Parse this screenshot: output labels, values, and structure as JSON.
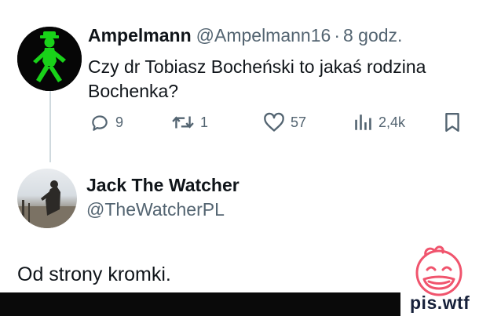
{
  "tweet": {
    "author_name": "Ampelmann",
    "author_handle": "@Ampelmann16",
    "separator": "·",
    "time": "8 godz.",
    "text": "Czy dr Tobiasz Bocheński to jakaś rodzina Bochenka?",
    "replies": "9",
    "retweets": "1",
    "likes": "57",
    "views": "2,4k"
  },
  "reply": {
    "author_name": "Jack The Watcher",
    "author_handle": "@TheWatcherPL",
    "text": "Od strony kromki."
  },
  "watermark": {
    "text": "pis.wtf",
    "color": "#f0546d"
  },
  "colors": {
    "ampelmann_green": "#19d219",
    "muted": "#536471",
    "text": "#0f1419"
  }
}
